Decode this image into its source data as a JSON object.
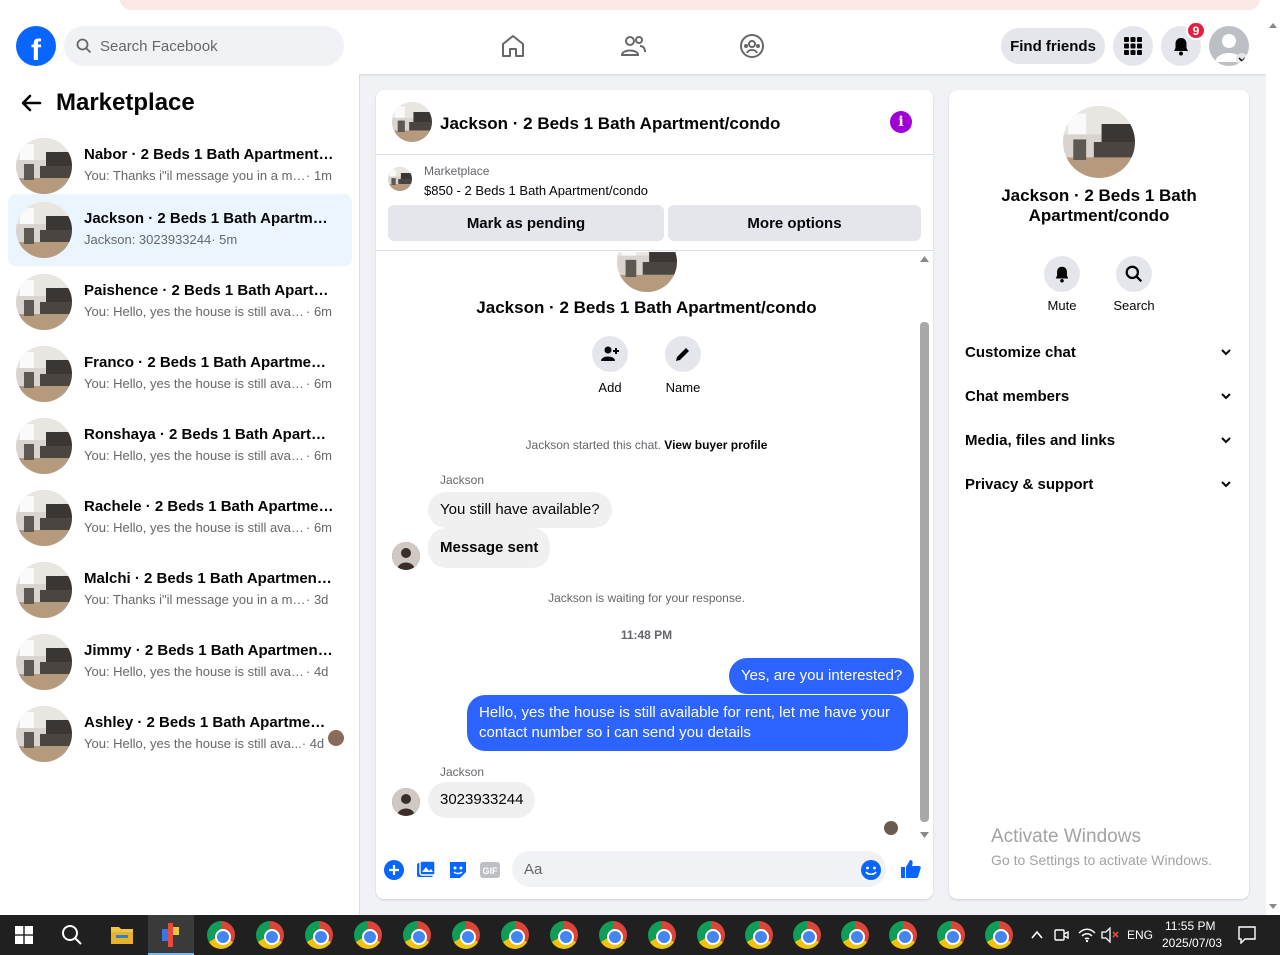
{
  "topbar": {
    "search_placeholder": "Search Facebook",
    "find_friends": "Find friends",
    "notification_count": "9"
  },
  "sidebar": {
    "title": "Marketplace",
    "conversations": [
      {
        "name": "Nabor · 2 Beds 1 Bath Apartment/condo",
        "preview": "You: Thanks i\"il message you in a mo...",
        "time": " · 1m"
      },
      {
        "name": "Jackson · 2 Beds 1 Bath Apartment/condo",
        "preview": "Jackson: 3023933244",
        "time": " · 5m"
      },
      {
        "name": "Paishence · 2 Beds 1 Bath Apartment/condo",
        "preview": "You: Hello, yes the house is still availa...",
        "time": " · 6m"
      },
      {
        "name": "Franco · 2 Beds 1 Bath Apartment/condo",
        "preview": "You: Hello, yes the house is still availa...",
        "time": " · 6m"
      },
      {
        "name": "Ronshaya · 2 Beds 1 Bath Apartment/condo",
        "preview": "You: Hello, yes the house is still availa...",
        "time": " · 6m"
      },
      {
        "name": "Rachele · 2 Beds 1 Bath Apartment/condo",
        "preview": "You: Hello, yes the house is still availa...",
        "time": " · 6m"
      },
      {
        "name": "Malchi · 2 Beds 1 Bath Apartment/condo",
        "preview": "You: Thanks i\"il message you in a mo...",
        "time": " · 3d"
      },
      {
        "name": "Jimmy · 2 Beds 1 Bath Apartment/condo",
        "preview": "You: Hello, yes the house is still availa...",
        "time": " · 4d"
      },
      {
        "name": "Ashley · 2 Beds 1 Bath Apartment/condo",
        "preview": "You: Hello, yes the house is still ava...",
        "time": " · 4d"
      }
    ]
  },
  "chat": {
    "title": "Jackson · 2 Beds 1 Bath Apartment/condo",
    "listing_source": "Marketplace",
    "listing_price": "$850 - 2 Beds 1 Bath Apartment/condo",
    "mark_pending": "Mark as pending",
    "more_options": "More options",
    "intro_title": "Jackson · 2 Beds 1 Bath Apartment/condo",
    "add_label": "Add",
    "name_label": "Name",
    "started_text": "Jackson started this chat.",
    "view_profile": "View buyer profile",
    "sender_name": "Jackson",
    "msg1": "You still have available?",
    "msg2": "Message sent",
    "waiting": "Jackson is waiting for your response.",
    "timestamp": "11:48 PM",
    "out1": "Yes, are you interested?",
    "out2": "Hello, yes the house is still available for rent, let me have your contact number so i can send you details",
    "sender_name2": "Jackson",
    "msg3": "3023933244",
    "composer_placeholder": "Aa"
  },
  "details": {
    "title": "Jackson · 2 Beds 1 Bath Apartment/condo",
    "mute": "Mute",
    "search": "Search",
    "sections": [
      "Customize chat",
      "Chat members",
      "Media, files and links",
      "Privacy & support"
    ]
  },
  "watermark": {
    "line1": "Activate Windows",
    "line2": "Go to Settings to activate Windows."
  },
  "taskbar": {
    "lang": "ENG",
    "time": "11:55 PM",
    "date": "2025/07/03"
  }
}
